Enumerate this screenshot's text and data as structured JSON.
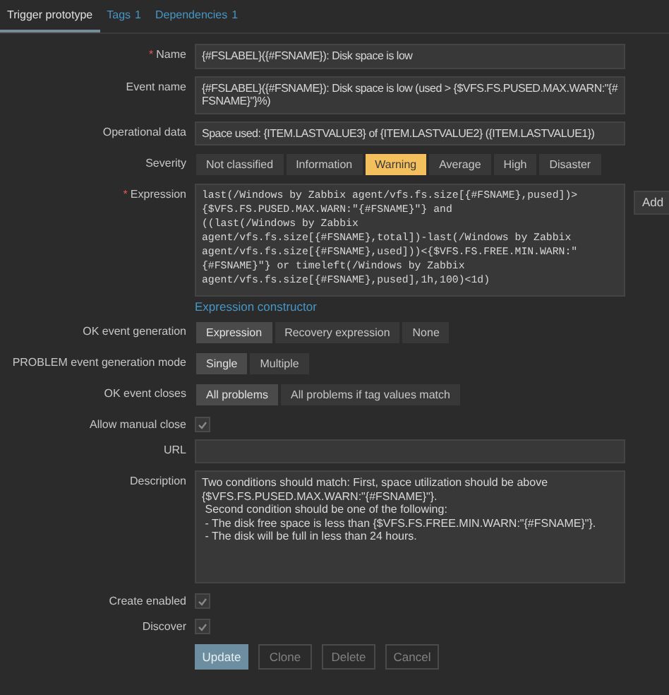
{
  "tabs": [
    {
      "label": "Trigger prototype",
      "selected": true
    },
    {
      "label": "Tags",
      "count": "1",
      "selected": false
    },
    {
      "label": "Dependencies",
      "count": "1",
      "selected": false
    }
  ],
  "fields": [
    {
      "kind": "text",
      "label": "Name",
      "required_mark": "*",
      "value": "{#FSLABEL}({#FSNAME}): Disk space is low"
    },
    {
      "kind": "text",
      "label": "Event name",
      "value": "{#FSLABEL}({#FSNAME}): Disk space is low (used > {$VFS.FS.PUSED.MAX.WARN:\"{#FSNAME}\"}%)"
    },
    {
      "kind": "text",
      "label": "Operational data",
      "value": "Space used: {ITEM.LASTVALUE3} of {ITEM.LASTVALUE2} ({ITEM.LASTVALUE1})"
    },
    {
      "kind": "segmented",
      "label": "Severity",
      "options": [
        {
          "label": "Not classified",
          "selected": false
        },
        {
          "label": "Information",
          "selected": false
        },
        {
          "label": "Warning",
          "selected": true
        },
        {
          "label": "Average",
          "selected": false
        },
        {
          "label": "High",
          "selected": false
        },
        {
          "label": "Disaster",
          "selected": false
        }
      ]
    },
    {
      "kind": "expression",
      "label": "Expression",
      "required_mark": "*",
      "value": "last(/Windows by Zabbix agent/vfs.fs.size[{#FSNAME},pused])>\n{$VFS.FS.PUSED.MAX.WARN:\"{#FSNAME}\"} and\n((last(/Windows by Zabbix\nagent/vfs.fs.size[{#FSNAME},total])-last(/Windows by Zabbix\nagent/vfs.fs.size[{#FSNAME},used]))<{$VFS.FS.FREE.MIN.WARN:\"\n{#FSNAME}\"} or timeleft(/Windows by Zabbix\nagent/vfs.fs.size[{#FSNAME},pused],1h,100)<1d)",
      "button": "Add",
      "link": "Expression constructor"
    },
    {
      "kind": "segmented",
      "label": "OK event generation",
      "options": [
        {
          "label": "Expression",
          "selected": true
        },
        {
          "label": "Recovery expression",
          "selected": false
        },
        {
          "label": "None",
          "selected": false
        }
      ]
    },
    {
      "kind": "segmented",
      "label": "PROBLEM event generation mode",
      "options": [
        {
          "label": "Single",
          "selected": true
        },
        {
          "label": "Multiple",
          "selected": false
        }
      ]
    },
    {
      "kind": "segmented",
      "label": "OK event closes",
      "options": [
        {
          "label": "All problems",
          "selected": true
        },
        {
          "label": "All problems if tag values match",
          "selected": false
        }
      ]
    },
    {
      "kind": "checkbox",
      "label": "Allow manual close",
      "checked": true
    },
    {
      "kind": "text",
      "label": "URL"
    },
    {
      "kind": "textarea",
      "label": "Description",
      "value": "Two conditions should match: First, space utilization should be above\n{$VFS.FS.PUSED.MAX.WARN:\"{#FSNAME}\"}.\n Second condition should be one of the following:\n - The disk free space is less than {$VFS.FS.FREE.MIN.WARN:\"{#FSNAME}\"}.\n - The disk will be full in less than 24 hours."
    },
    {
      "kind": "checkbox",
      "label": "Create enabled",
      "checked": true
    },
    {
      "kind": "checkbox",
      "label": "Discover",
      "checked": true
    }
  ],
  "buttons": [
    {
      "label": "Update",
      "kind": "primary"
    },
    {
      "label": "Clone",
      "kind": "secondary"
    },
    {
      "label": "Delete",
      "kind": "secondary"
    },
    {
      "label": "Cancel",
      "kind": "secondary"
    }
  ]
}
